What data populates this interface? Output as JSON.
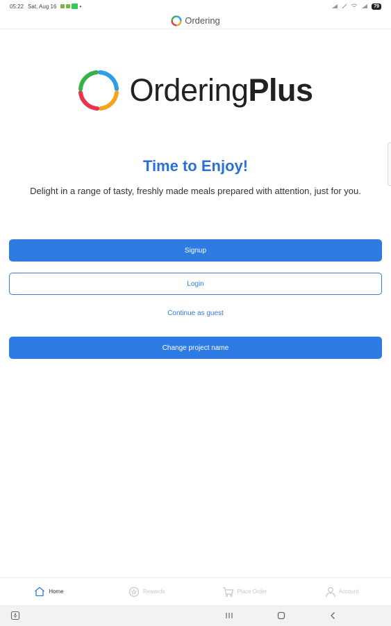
{
  "status_bar": {
    "time": "05:22",
    "date": "Sat, Aug 16",
    "battery": "79"
  },
  "header": {
    "title": "Ordering"
  },
  "logo": {
    "text_regular": "Ordering",
    "text_bold": "Plus",
    "colors": [
      "#2e9ee8",
      "#f4a41f",
      "#e8334e",
      "#35b24a"
    ]
  },
  "welcome": {
    "title": "Time to Enjoy!",
    "description": "Delight in a range of tasty, freshly made meals prepared with attention, just for you."
  },
  "actions": {
    "signup_label": "Signup",
    "login_label": "Login",
    "guest_label": "Continue as guest",
    "change_project_label": "Change project name"
  },
  "tabs": [
    {
      "label": "Home",
      "icon": "home-icon",
      "active": true
    },
    {
      "label": "Rewards",
      "icon": "rewards-icon",
      "active": false
    },
    {
      "label": "Place Order",
      "icon": "cart-icon",
      "active": false
    },
    {
      "label": "Account",
      "icon": "user-icon",
      "active": false
    }
  ],
  "theme": {
    "accent": "#2e7be4",
    "title_color": "#2b6fdc"
  }
}
